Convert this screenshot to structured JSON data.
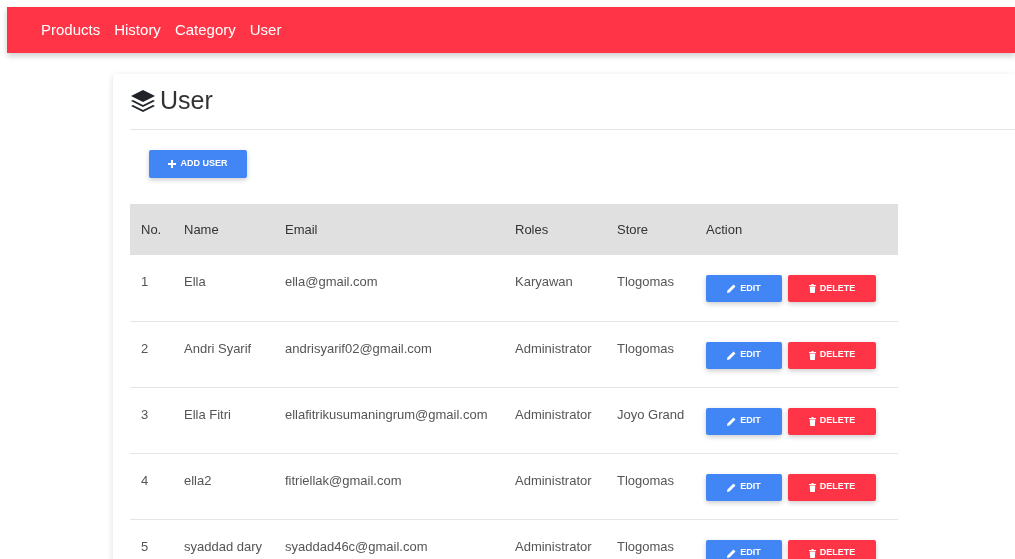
{
  "nav": [
    "Products",
    "History",
    "Category",
    "User"
  ],
  "page": {
    "title": "User",
    "add_button": "ADD USER"
  },
  "table": {
    "columns": [
      "No.",
      "Name",
      "Email",
      "Roles",
      "Store",
      "Action"
    ],
    "rows": [
      {
        "no": "1",
        "name": "Ella",
        "email": "ella@gmail.com",
        "role": "Karyawan",
        "store": "Tlogomas",
        "edit": "EDIT",
        "delete": "DELETE"
      },
      {
        "no": "2",
        "name": "Andri Syarif",
        "email": "andrisyarif02@gmail.com",
        "role": "Administrator",
        "store": "Tlogomas",
        "edit": "EDIT",
        "delete": "DELETE"
      },
      {
        "no": "3",
        "name": "Ella Fitri",
        "email": "ellafitrikusumaningrum@gmail.com",
        "role": "Administrator",
        "store": "Joyo Grand",
        "edit": "EDIT",
        "delete": "DELETE"
      },
      {
        "no": "4",
        "name": "ella2",
        "email": "fitriellak@gmail.com",
        "role": "Administrator",
        "store": "Tlogomas",
        "edit": "EDIT",
        "delete": "DELETE"
      },
      {
        "no": "5",
        "name": "syaddad dary",
        "email": "syaddad46c@gmail.com",
        "role": "Administrator",
        "store": "Tlogomas",
        "edit": "EDIT",
        "delete": "DELETE"
      }
    ]
  }
}
